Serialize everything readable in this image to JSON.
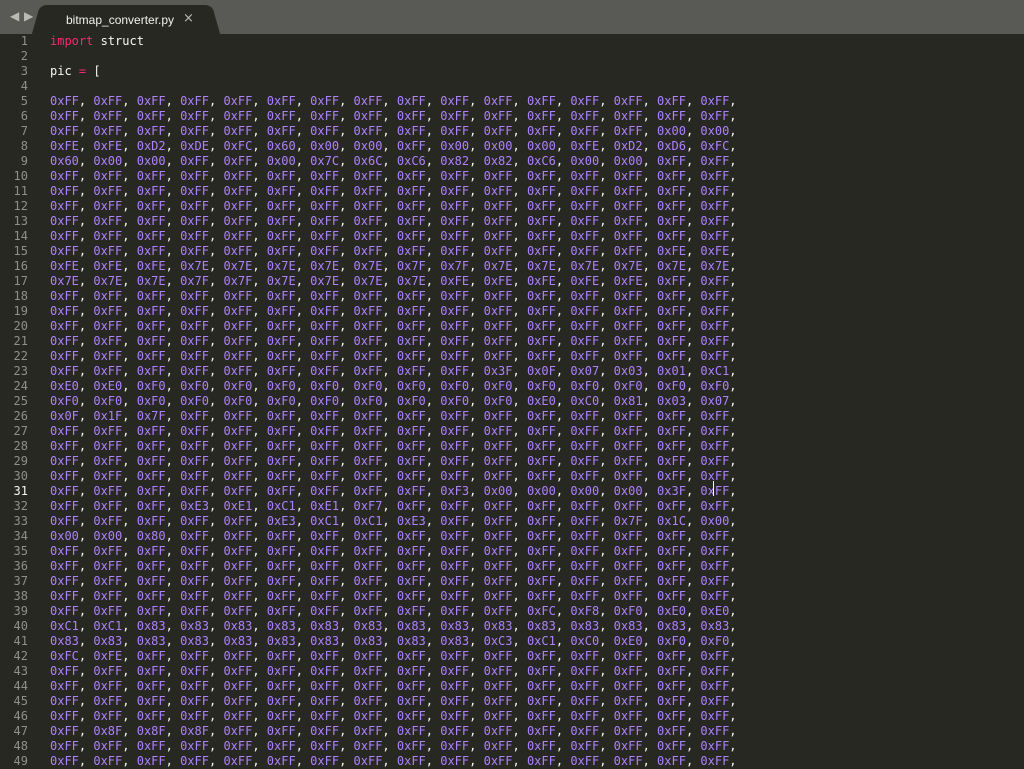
{
  "tabbar": {
    "back_icon": "◀",
    "forward_icon": "▶",
    "active_tab": "bitmap_converter.py",
    "close_icon": "×"
  },
  "editor": {
    "lines": [
      {
        "n": 1,
        "text": "import struct"
      },
      {
        "n": 2,
        "text": ""
      },
      {
        "n": 3,
        "text": "pic = ["
      },
      {
        "n": 4,
        "text": ""
      },
      {
        "n": 5,
        "text": "0xFF, 0xFF, 0xFF, 0xFF, 0xFF, 0xFF, 0xFF, 0xFF, 0xFF, 0xFF, 0xFF, 0xFF, 0xFF, 0xFF, 0xFF, 0xFF,"
      },
      {
        "n": 6,
        "text": "0xFF, 0xFF, 0xFF, 0xFF, 0xFF, 0xFF, 0xFF, 0xFF, 0xFF, 0xFF, 0xFF, 0xFF, 0xFF, 0xFF, 0xFF, 0xFF,"
      },
      {
        "n": 7,
        "text": "0xFF, 0xFF, 0xFF, 0xFF, 0xFF, 0xFF, 0xFF, 0xFF, 0xFF, 0xFF, 0xFF, 0xFF, 0xFF, 0xFF, 0x00, 0x00,"
      },
      {
        "n": 8,
        "text": "0xFE, 0xFE, 0xD2, 0xDE, 0xFC, 0x60, 0x00, 0x00, 0xFF, 0x00, 0x00, 0x00, 0xFE, 0xD2, 0xD6, 0xFC,"
      },
      {
        "n": 9,
        "text": "0x60, 0x00, 0x00, 0xFF, 0xFF, 0x00, 0x7C, 0x6C, 0xC6, 0x82, 0x82, 0xC6, 0x00, 0x00, 0xFF, 0xFF,"
      },
      {
        "n": 10,
        "text": "0xFF, 0xFF, 0xFF, 0xFF, 0xFF, 0xFF, 0xFF, 0xFF, 0xFF, 0xFF, 0xFF, 0xFF, 0xFF, 0xFF, 0xFF, 0xFF,"
      },
      {
        "n": 11,
        "text": "0xFF, 0xFF, 0xFF, 0xFF, 0xFF, 0xFF, 0xFF, 0xFF, 0xFF, 0xFF, 0xFF, 0xFF, 0xFF, 0xFF, 0xFF, 0xFF,"
      },
      {
        "n": 12,
        "text": "0xFF, 0xFF, 0xFF, 0xFF, 0xFF, 0xFF, 0xFF, 0xFF, 0xFF, 0xFF, 0xFF, 0xFF, 0xFF, 0xFF, 0xFF, 0xFF,"
      },
      {
        "n": 13,
        "text": "0xFF, 0xFF, 0xFF, 0xFF, 0xFF, 0xFF, 0xFF, 0xFF, 0xFF, 0xFF, 0xFF, 0xFF, 0xFF, 0xFF, 0xFF, 0xFF,"
      },
      {
        "n": 14,
        "text": "0xFF, 0xFF, 0xFF, 0xFF, 0xFF, 0xFF, 0xFF, 0xFF, 0xFF, 0xFF, 0xFF, 0xFF, 0xFF, 0xFF, 0xFF, 0xFF,"
      },
      {
        "n": 15,
        "text": "0xFF, 0xFF, 0xFF, 0xFF, 0xFF, 0xFF, 0xFF, 0xFF, 0xFF, 0xFF, 0xFF, 0xFF, 0xFF, 0xFF, 0xFE, 0xFE,"
      },
      {
        "n": 16,
        "text": "0xFE, 0xFE, 0xFE, 0x7E, 0x7E, 0x7E, 0x7E, 0x7E, 0x7F, 0x7F, 0x7E, 0x7E, 0x7E, 0x7E, 0x7E, 0x7E,"
      },
      {
        "n": 17,
        "text": "0x7E, 0x7E, 0x7E, 0x7F, 0x7F, 0x7E, 0x7E, 0x7E, 0x7E, 0xFE, 0xFE, 0xFE, 0xFE, 0xFE, 0xFF, 0xFF,"
      },
      {
        "n": 18,
        "text": "0xFF, 0xFF, 0xFF, 0xFF, 0xFF, 0xFF, 0xFF, 0xFF, 0xFF, 0xFF, 0xFF, 0xFF, 0xFF, 0xFF, 0xFF, 0xFF,"
      },
      {
        "n": 19,
        "text": "0xFF, 0xFF, 0xFF, 0xFF, 0xFF, 0xFF, 0xFF, 0xFF, 0xFF, 0xFF, 0xFF, 0xFF, 0xFF, 0xFF, 0xFF, 0xFF,"
      },
      {
        "n": 20,
        "text": "0xFF, 0xFF, 0xFF, 0xFF, 0xFF, 0xFF, 0xFF, 0xFF, 0xFF, 0xFF, 0xFF, 0xFF, 0xFF, 0xFF, 0xFF, 0xFF,"
      },
      {
        "n": 21,
        "text": "0xFF, 0xFF, 0xFF, 0xFF, 0xFF, 0xFF, 0xFF, 0xFF, 0xFF, 0xFF, 0xFF, 0xFF, 0xFF, 0xFF, 0xFF, 0xFF,"
      },
      {
        "n": 22,
        "text": "0xFF, 0xFF, 0xFF, 0xFF, 0xFF, 0xFF, 0xFF, 0xFF, 0xFF, 0xFF, 0xFF, 0xFF, 0xFF, 0xFF, 0xFF, 0xFF,"
      },
      {
        "n": 23,
        "text": "0xFF, 0xFF, 0xFF, 0xFF, 0xFF, 0xFF, 0xFF, 0xFF, 0xFF, 0xFF, 0x3F, 0x0F, 0x07, 0x03, 0x01, 0xC1,"
      },
      {
        "n": 24,
        "text": "0xE0, 0xE0, 0xF0, 0xF0, 0xF0, 0xF0, 0xF0, 0xF0, 0xF0, 0xF0, 0xF0, 0xF0, 0xF0, 0xF0, 0xF0, 0xF0,"
      },
      {
        "n": 25,
        "text": "0xF0, 0xF0, 0xF0, 0xF0, 0xF0, 0xF0, 0xF0, 0xF0, 0xF0, 0xF0, 0xF0, 0xE0, 0xC0, 0x81, 0x03, 0x07,"
      },
      {
        "n": 26,
        "text": "0x0F, 0x1F, 0x7F, 0xFF, 0xFF, 0xFF, 0xFF, 0xFF, 0xFF, 0xFF, 0xFF, 0xFF, 0xFF, 0xFF, 0xFF, 0xFF,"
      },
      {
        "n": 27,
        "text": "0xFF, 0xFF, 0xFF, 0xFF, 0xFF, 0xFF, 0xFF, 0xFF, 0xFF, 0xFF, 0xFF, 0xFF, 0xFF, 0xFF, 0xFF, 0xFF,"
      },
      {
        "n": 28,
        "text": "0xFF, 0xFF, 0xFF, 0xFF, 0xFF, 0xFF, 0xFF, 0xFF, 0xFF, 0xFF, 0xFF, 0xFF, 0xFF, 0xFF, 0xFF, 0xFF,"
      },
      {
        "n": 29,
        "text": "0xFF, 0xFF, 0xFF, 0xFF, 0xFF, 0xFF, 0xFF, 0xFF, 0xFF, 0xFF, 0xFF, 0xFF, 0xFF, 0xFF, 0xFF, 0xFF,"
      },
      {
        "n": 30,
        "text": "0xFF, 0xFF, 0xFF, 0xFF, 0xFF, 0xFF, 0xFF, 0xFF, 0xFF, 0xFF, 0xFF, 0xFF, 0xFF, 0xFF, 0xFF, 0xFF,"
      },
      {
        "n": 31,
        "text": "0xFF, 0xFF, 0xFF, 0xFF, 0xFF, 0xFF, 0xFF, 0xFF, 0xFF, 0xF3, 0x00, 0x00, 0x00, 0x00, 0x3F, 0xFF,"
      },
      {
        "n": 32,
        "text": "0xFF, 0xFF, 0xFF, 0xE3, 0xE1, 0xC1, 0xE1, 0xF7, 0xFF, 0xFF, 0xFF, 0xFF, 0xFF, 0xFF, 0xFF, 0xFF,"
      },
      {
        "n": 33,
        "text": "0xFF, 0xFF, 0xFF, 0xFF, 0xFF, 0xE3, 0xC1, 0xC1, 0xE3, 0xFF, 0xFF, 0xFF, 0xFF, 0x7F, 0x1C, 0x00,"
      },
      {
        "n": 34,
        "text": "0x00, 0x00, 0x80, 0xFF, 0xFF, 0xFF, 0xFF, 0xFF, 0xFF, 0xFF, 0xFF, 0xFF, 0xFF, 0xFF, 0xFF, 0xFF,"
      },
      {
        "n": 35,
        "text": "0xFF, 0xFF, 0xFF, 0xFF, 0xFF, 0xFF, 0xFF, 0xFF, 0xFF, 0xFF, 0xFF, 0xFF, 0xFF, 0xFF, 0xFF, 0xFF,"
      },
      {
        "n": 36,
        "text": "0xFF, 0xFF, 0xFF, 0xFF, 0xFF, 0xFF, 0xFF, 0xFF, 0xFF, 0xFF, 0xFF, 0xFF, 0xFF, 0xFF, 0xFF, 0xFF,"
      },
      {
        "n": 37,
        "text": "0xFF, 0xFF, 0xFF, 0xFF, 0xFF, 0xFF, 0xFF, 0xFF, 0xFF, 0xFF, 0xFF, 0xFF, 0xFF, 0xFF, 0xFF, 0xFF,"
      },
      {
        "n": 38,
        "text": "0xFF, 0xFF, 0xFF, 0xFF, 0xFF, 0xFF, 0xFF, 0xFF, 0xFF, 0xFF, 0xFF, 0xFF, 0xFF, 0xFF, 0xFF, 0xFF,"
      },
      {
        "n": 39,
        "text": "0xFF, 0xFF, 0xFF, 0xFF, 0xFF, 0xFF, 0xFF, 0xFF, 0xFF, 0xFF, 0xFF, 0xFC, 0xF8, 0xF0, 0xE0, 0xE0,"
      },
      {
        "n": 40,
        "text": "0xC1, 0xC1, 0x83, 0x83, 0x83, 0x83, 0x83, 0x83, 0x83, 0x83, 0x83, 0x83, 0x83, 0x83, 0x83, 0x83,"
      },
      {
        "n": 41,
        "text": "0x83, 0x83, 0x83, 0x83, 0x83, 0x83, 0x83, 0x83, 0x83, 0x83, 0xC3, 0xC1, 0xC0, 0xE0, 0xF0, 0xF0,"
      },
      {
        "n": 42,
        "text": "0xFC, 0xFE, 0xFF, 0xFF, 0xFF, 0xFF, 0xFF, 0xFF, 0xFF, 0xFF, 0xFF, 0xFF, 0xFF, 0xFF, 0xFF, 0xFF,"
      },
      {
        "n": 43,
        "text": "0xFF, 0xFF, 0xFF, 0xFF, 0xFF, 0xFF, 0xFF, 0xFF, 0xFF, 0xFF, 0xFF, 0xFF, 0xFF, 0xFF, 0xFF, 0xFF,"
      },
      {
        "n": 44,
        "text": "0xFF, 0xFF, 0xFF, 0xFF, 0xFF, 0xFF, 0xFF, 0xFF, 0xFF, 0xFF, 0xFF, 0xFF, 0xFF, 0xFF, 0xFF, 0xFF,"
      },
      {
        "n": 45,
        "text": "0xFF, 0xFF, 0xFF, 0xFF, 0xFF, 0xFF, 0xFF, 0xFF, 0xFF, 0xFF, 0xFF, 0xFF, 0xFF, 0xFF, 0xFF, 0xFF,"
      },
      {
        "n": 46,
        "text": "0xFF, 0xFF, 0xFF, 0xFF, 0xFF, 0xFF, 0xFF, 0xFF, 0xFF, 0xFF, 0xFF, 0xFF, 0xFF, 0xFF, 0xFF, 0xFF,"
      },
      {
        "n": 47,
        "text": "0xFF, 0x8F, 0x8F, 0x8F, 0xFF, 0xFF, 0xFF, 0xFF, 0xFF, 0xFF, 0xFF, 0xFF, 0xFF, 0xFF, 0xFF, 0xFF,"
      },
      {
        "n": 48,
        "text": "0xFF, 0xFF, 0xFF, 0xFF, 0xFF, 0xFF, 0xFF, 0xFF, 0xFF, 0xFF, 0xFF, 0xFF, 0xFF, 0xFF, 0xFF, 0xFF,"
      },
      {
        "n": 49,
        "text": "0xFF, 0xFF, 0xFF, 0xFF, 0xFF, 0xFF, 0xFF, 0xFF, 0xFF, 0xFF, 0xFF, 0xFF, 0xFF, 0xFF, 0xFF, 0xFF,"
      }
    ],
    "active_line": 31
  }
}
